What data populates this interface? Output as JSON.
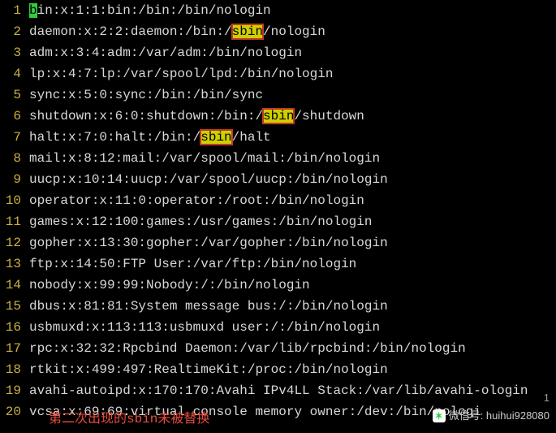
{
  "lines": [
    {
      "n": "1",
      "segs": [
        {
          "t": "b",
          "cls": "cursor"
        },
        {
          "t": "in:x:1:1:bin:/bin:/bin/nologin"
        }
      ]
    },
    {
      "n": "2",
      "segs": [
        {
          "t": "daemon:x:2:2:daemon:/bin:/"
        },
        {
          "t": "sbin",
          "cls": "hl box"
        },
        {
          "t": "/nologin"
        }
      ]
    },
    {
      "n": "3",
      "segs": [
        {
          "t": "adm:x:3:4:adm:/var/adm:/bin/nologin"
        }
      ]
    },
    {
      "n": "4",
      "segs": [
        {
          "t": "lp:x:4:7:lp:/var/spool/lpd:/bin/nologin"
        }
      ]
    },
    {
      "n": "5",
      "segs": [
        {
          "t": "sync:x:5:0:sync:/bin:/bin/sync"
        }
      ]
    },
    {
      "n": "6",
      "segs": [
        {
          "t": "shutdown:x:6:0:shutdown:/bin:/"
        },
        {
          "t": "sbin",
          "cls": "hl box"
        },
        {
          "t": "/shutdown"
        }
      ]
    },
    {
      "n": "7",
      "segs": [
        {
          "t": "halt:x:7:0:halt:/bin:/"
        },
        {
          "t": "sbin",
          "cls": "hl box"
        },
        {
          "t": "/halt"
        }
      ]
    },
    {
      "n": "8",
      "segs": [
        {
          "t": "mail:x:8:12:mail:/var/spool/mail:/bin/nologin"
        }
      ]
    },
    {
      "n": "9",
      "segs": [
        {
          "t": "uucp:x:10:14:uucp:/var/spool/uucp:/bin/nologin"
        }
      ]
    },
    {
      "n": "10",
      "segs": [
        {
          "t": "operator:x:11:0:operator:/root:/bin/nologin"
        }
      ]
    },
    {
      "n": "11",
      "segs": [
        {
          "t": "games:x:12:100:games:/usr/games:/bin/nologin"
        }
      ]
    },
    {
      "n": "12",
      "segs": [
        {
          "t": "gopher:x:13:30:gopher:/var/gopher:/bin/nologin"
        }
      ]
    },
    {
      "n": "13",
      "segs": [
        {
          "t": "ftp:x:14:50:FTP User:/var/ftp:/bin/nologin"
        }
      ]
    },
    {
      "n": "14",
      "segs": [
        {
          "t": "nobody:x:99:99:Nobody:/:/bin/nologin"
        }
      ]
    },
    {
      "n": "15",
      "segs": [
        {
          "t": "dbus:x:81:81:System message bus:/:/bin/nologin"
        }
      ]
    },
    {
      "n": "16",
      "segs": [
        {
          "t": "usbmuxd:x:113:113:usbmuxd user:/:/bin/nologin"
        }
      ]
    },
    {
      "n": "17",
      "segs": [
        {
          "t": "rpc:x:32:32:Rpcbind Daemon:/var/lib/rpcbind:/bin/nologin"
        }
      ]
    },
    {
      "n": "18",
      "segs": [
        {
          "t": "rtkit:x:499:497:RealtimeKit:/proc:/bin/nologin"
        }
      ]
    },
    {
      "n": "19",
      "segs": [
        {
          "t": "avahi-autoipd:x:170:170:Avahi IPv4LL Stack:/var/lib/avahi-ologin"
        }
      ]
    },
    {
      "n": "20",
      "segs": [
        {
          "t": "vcsa:x:69:69:virtual console memory owner:/dev:/bin/nologi"
        }
      ]
    }
  ],
  "annotation": "第二次出现的sbin未被替换",
  "watermark_label": "微信号: huihui928080",
  "page_indicator": "1"
}
